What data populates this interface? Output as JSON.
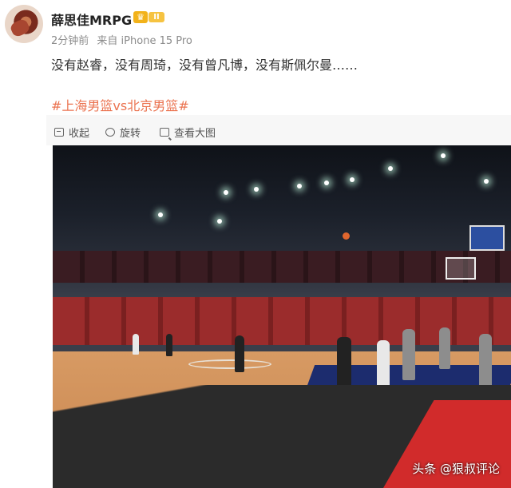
{
  "post": {
    "username": "薛思佳MRPG",
    "badge_level": "II",
    "time": "2分钟前",
    "source": "来自 iPhone 15 Pro",
    "text": "没有赵睿，没有周琦，没有曾凡博，没有斯佩尔曼……",
    "hashtag": "#上海男篮vs北京男篮#"
  },
  "toolbar": {
    "collapse": "收起",
    "rotate": "旋转",
    "view_large": "查看大图"
  },
  "photo": {
    "watermark": "头条 @狠叔评论"
  },
  "icons": {
    "crown": "crown-icon",
    "collapse": "collapse-icon",
    "rotate": "rotate-icon",
    "view_large": "zoom-icon"
  },
  "colors": {
    "hashtag": "#eb7350",
    "muted": "#8c8c8c"
  }
}
